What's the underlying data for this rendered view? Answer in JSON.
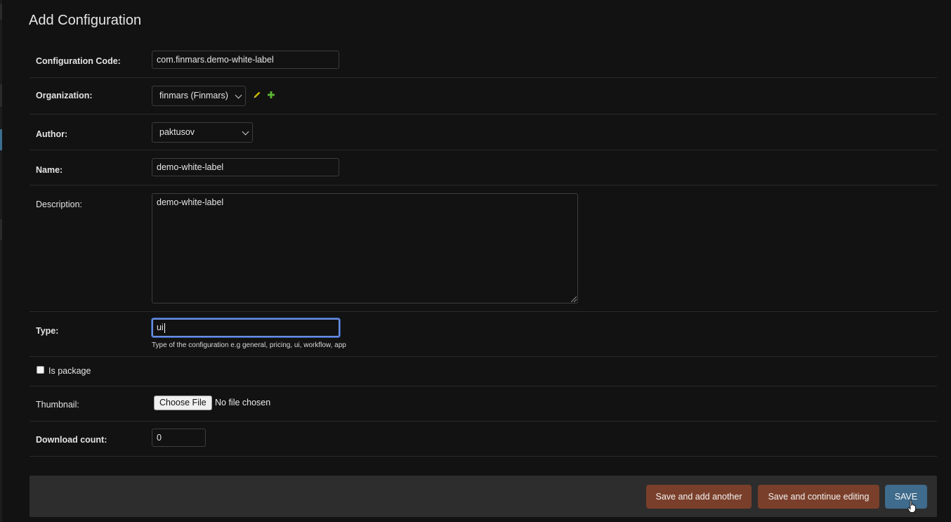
{
  "page": {
    "title": "Add Configuration"
  },
  "fields": {
    "configuration_code": {
      "label": "Configuration Code:",
      "value": "com.finmars.demo-white-label"
    },
    "organization": {
      "label": "Organization:",
      "selected": "finmars (Finmars)"
    },
    "author": {
      "label": "Author:",
      "selected": "paktusov"
    },
    "name": {
      "label": "Name:",
      "value": "demo-white-label"
    },
    "description": {
      "label": "Description:",
      "value": "demo-white-label"
    },
    "type": {
      "label": "Type:",
      "value": "ui",
      "help": "Type of the configuration e.g general, pricing, ui, workflow, app"
    },
    "is_package": {
      "label": "Is package",
      "checked": false
    },
    "thumbnail": {
      "label": "Thumbnail:",
      "button_label": "Choose File",
      "status": "No file chosen"
    },
    "download_count": {
      "label": "Download count:",
      "value": "0"
    }
  },
  "actions": {
    "save_add_another": "Save and add another",
    "save_continue": "Save and continue editing",
    "save": "SAVE"
  },
  "colors": {
    "background": "#121212",
    "secondary_button": "#7a3f2a",
    "primary_button": "#3f6b8c",
    "focus_ring": "#6a8fe0",
    "edit_icon": "#c8b400",
    "add_icon": "#5bb833"
  },
  "icons": {
    "edit": "pencil-icon",
    "add": "plus-icon",
    "select_arrow": "chevron-down-icon",
    "pointer": "hand-cursor-icon"
  }
}
